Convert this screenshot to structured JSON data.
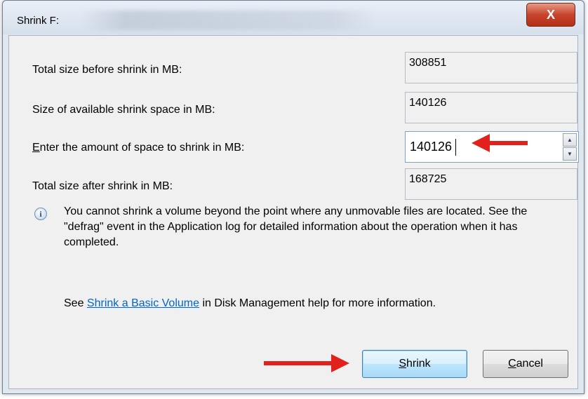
{
  "window": {
    "title": "Shrink F:",
    "close_glyph": "X"
  },
  "rows": {
    "total_before_label_pre": "Total size before shrink in MB:",
    "total_before_value": "308851",
    "available_label": "Size of available shrink space in MB:",
    "available_value": "140126",
    "enter_label_mnemonic": "E",
    "enter_label_rest": "nter the amount of space to shrink in MB:",
    "enter_value": "140126",
    "total_after_label": "Total size after shrink in MB:",
    "total_after_value": "168725"
  },
  "spinner": {
    "up_glyph": "▲",
    "down_glyph": "▼"
  },
  "info": {
    "icon": "info-icon",
    "text": "You cannot shrink a volume beyond the point where any unmovable files are located. See the \"defrag\" event in the Application log for detailed information about the operation when it has completed."
  },
  "help": {
    "prefix": "See ",
    "link": "Shrink a Basic Volume",
    "suffix": " in Disk Management help for more information."
  },
  "buttons": {
    "shrink_mnemonic": "S",
    "shrink_rest": "hrink",
    "cancel_mnemonic": "C",
    "cancel_rest": "ancel"
  },
  "colors": {
    "annotation_arrow": "#e3211c",
    "link": "#0066cc"
  }
}
